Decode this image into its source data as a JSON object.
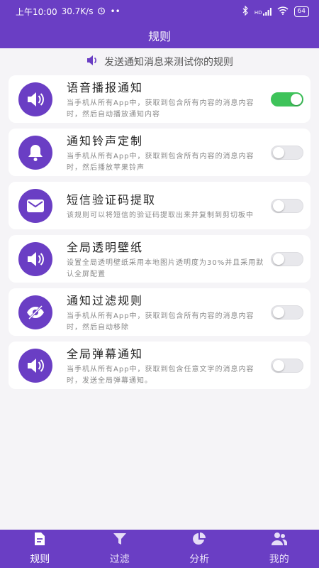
{
  "status_bar": {
    "time": "上午10:00",
    "net_speed": "30.7K/s",
    "dots": "••",
    "signal": "HD",
    "battery": "64"
  },
  "header": {
    "title": "规则"
  },
  "hint": {
    "text": "发送通知消息来测试你的规则"
  },
  "rules": [
    {
      "title": "语音播报通知",
      "desc": "当手机从所有App中，获取到包含所有内容的消息内容时，然后自动播放通知内容",
      "icon": "speaker-icon",
      "enabled": true
    },
    {
      "title": "通知铃声定制",
      "desc": "当手机从所有App中，获取到包含所有内容的消息内容时，然后播放苹果铃声",
      "icon": "bell-icon",
      "enabled": false
    },
    {
      "title": "短信验证码提取",
      "desc": "该规则可以将短信的验证码提取出来并复制到剪切板中",
      "icon": "mail-icon",
      "enabled": false
    },
    {
      "title": "全局透明壁纸",
      "desc": "设置全局透明壁纸采用本地图片透明度为30%并且采用默认全屏配置",
      "icon": "speaker-icon",
      "enabled": false
    },
    {
      "title": "通知过滤规则",
      "desc": "当手机从所有App中，获取到包含所有内容的消息内容时，然后自动移除",
      "icon": "eye-off-icon",
      "enabled": false
    },
    {
      "title": "全局弹幕通知",
      "desc": "当手机从所有App中，获取到包含任意文字的消息内容时，发送全局弹幕通知。",
      "icon": "speaker-icon",
      "enabled": false
    }
  ],
  "tabs": [
    {
      "label": "规则",
      "icon": "document-icon",
      "active": true
    },
    {
      "label": "过滤",
      "icon": "funnel-icon",
      "active": false
    },
    {
      "label": "分析",
      "icon": "pie-chart-icon",
      "active": false
    },
    {
      "label": "我的",
      "icon": "user-icon",
      "active": false
    }
  ],
  "colors": {
    "accent": "#6a3ec4",
    "toggle_on": "#3ec35a"
  }
}
